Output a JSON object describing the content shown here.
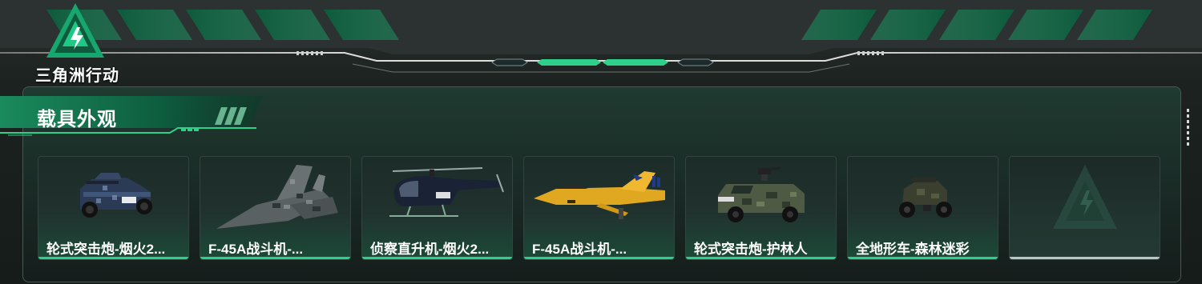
{
  "brand": {
    "logo_text": "三角洲行动"
  },
  "section": {
    "title": "载具外观"
  },
  "colors": {
    "accent": "#2fd08a",
    "panel_border": "#4a5753",
    "empty_underline": "#bfc3c2"
  },
  "vehicles": [
    {
      "label": "轮式突击炮-烟火2...",
      "icon": "armored-car-icon"
    },
    {
      "label": "F-45A战斗机-...",
      "icon": "fighter-jet-icon"
    },
    {
      "label": "侦察直升机-烟火2...",
      "icon": "helicopter-icon"
    },
    {
      "label": "F-45A战斗机-...",
      "icon": "yellow-fighter-jet-icon"
    },
    {
      "label": "轮式突击炮-护林人",
      "icon": "armored-car-camo-icon"
    },
    {
      "label": "全地形车-森林迷彩",
      "icon": "atv-icon"
    },
    {
      "label": "",
      "icon": "empty-slot-logo-icon"
    }
  ]
}
